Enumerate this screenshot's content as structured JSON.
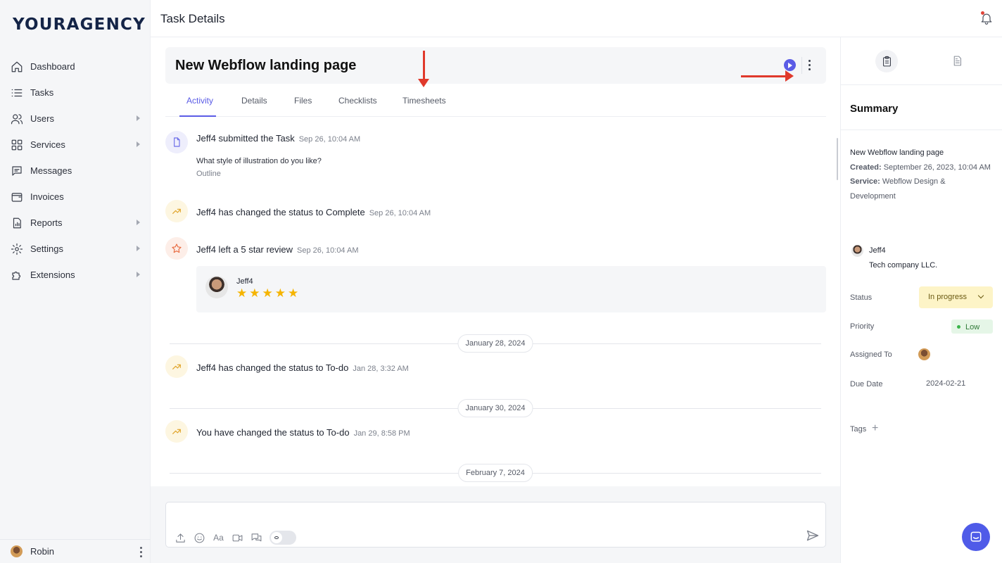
{
  "brand": {
    "logo": "YOURAGENCY"
  },
  "sidebar": {
    "items": [
      {
        "label": "Dashboard",
        "icon": "home-icon"
      },
      {
        "label": "Tasks",
        "icon": "list-icon"
      },
      {
        "label": "Users",
        "icon": "users-icon",
        "expandable": true
      },
      {
        "label": "Services",
        "icon": "grid-icon",
        "expandable": true
      },
      {
        "label": "Messages",
        "icon": "message-icon"
      },
      {
        "label": "Invoices",
        "icon": "wallet-icon"
      },
      {
        "label": "Reports",
        "icon": "report-icon",
        "expandable": true
      },
      {
        "label": "Settings",
        "icon": "gear-icon",
        "expandable": true
      },
      {
        "label": "Extensions",
        "icon": "puzzle-icon",
        "expandable": true
      }
    ],
    "user": {
      "name": "Robin"
    }
  },
  "header": {
    "title": "Task Details"
  },
  "task": {
    "title": "New Webflow landing page",
    "tabs": [
      "Activity",
      "Details",
      "Files",
      "Checklists",
      "Timesheets"
    ],
    "active_tab": "Activity"
  },
  "activity": [
    {
      "icon": "document-icon",
      "text": "Jeff4 submitted the Task",
      "time": "Sep 26, 10:04 AM",
      "question": "What style of illustration do you like?",
      "answer": "Outline"
    },
    {
      "icon": "trend-icon",
      "text": "Jeff4 has changed the status to Complete",
      "time": "Sep 26, 10:04 AM"
    },
    {
      "icon": "star-icon",
      "text": "Jeff4 left a 5 star review",
      "time": "Sep 26, 10:04 AM",
      "review": {
        "name": "Jeff4",
        "rating": 5,
        "stars": "★★★★★"
      }
    },
    {
      "icon": "trend-icon",
      "text": "Jeff4 has changed the status to To-do",
      "time": "Jan 28, 3:32 AM"
    },
    {
      "icon": "trend-icon",
      "text": "You have changed the status to To-do",
      "time": "Jan 29, 8:58 PM"
    }
  ],
  "date_separators": [
    "January 28, 2024",
    "January 30, 2024",
    "February 7, 2024"
  ],
  "summary": {
    "title": "Summary",
    "task_name": "New Webflow landing page",
    "created_label": "Created:",
    "created_value": "September 26, 2023, 10:04 AM",
    "service_label": "Service:",
    "service_value": "Webflow Design & Development",
    "client_name": "Jeff4",
    "client_company": "Tech company LLC.",
    "status_label": "Status",
    "status_value": "In progress",
    "priority_label": "Priority",
    "priority_value": "Low",
    "assigned_label": "Assigned To",
    "due_label": "Due Date",
    "due_value": "2024-02-21",
    "tags_label": "Tags"
  },
  "colors": {
    "accent": "#5b5ce6",
    "annotation_arrow": "#e0392b",
    "status_bg": "#fdf4c7",
    "priority_bg": "#e5f6e7",
    "star": "#f5b400"
  }
}
